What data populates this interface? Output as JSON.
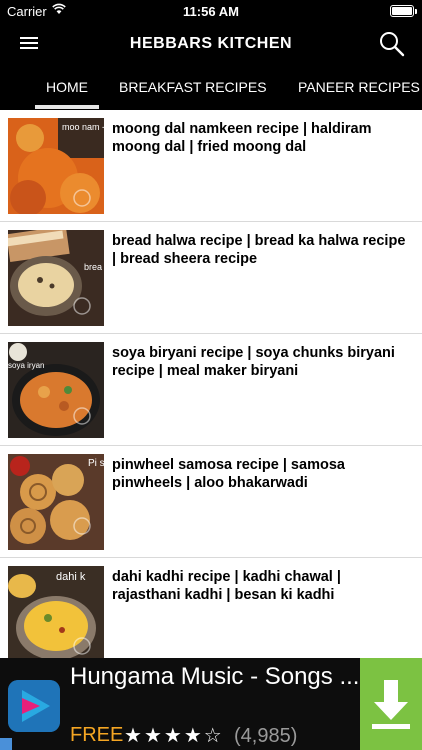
{
  "status": {
    "carrier": "Carrier",
    "time": "11:56 AM"
  },
  "app": {
    "title": "HEBBARS KITCHEN"
  },
  "tabs": [
    {
      "label": "HOME",
      "selected": true
    },
    {
      "label": "BREAKFAST RECIPES",
      "selected": false
    },
    {
      "label": "PANEER RECIPES",
      "selected": false
    }
  ],
  "recipes": [
    {
      "title": "moong dal namkeen recipe | haldiram moong dal | fried moong dal",
      "thumb_overlay": "moo nam - haldi"
    },
    {
      "title": "bread halwa recipe | bread ka halwa recipe | bread sheera recipe",
      "thumb_overlay": "brea halv"
    },
    {
      "title": "soya biryani recipe | soya chunks biryani recipe | meal maker biryani",
      "thumb_overlay": "soya iryan"
    },
    {
      "title": "pinwheel samosa recipe | samosa pinwheels | aloo bhakarwadi",
      "thumb_overlay": "Pi s"
    },
    {
      "title": "dahi kadhi recipe | kadhi chawal | rajasthani kadhi | besan ki kadhi",
      "thumb_overlay": "dahi k"
    }
  ],
  "ad": {
    "app_name": "Hungama Music - Songs ...",
    "price": "FREE",
    "rating": 4,
    "rating_max": 5,
    "rating_count": "(4,985)",
    "accent": "#7cc242",
    "icon": "play-triangle-icon"
  }
}
